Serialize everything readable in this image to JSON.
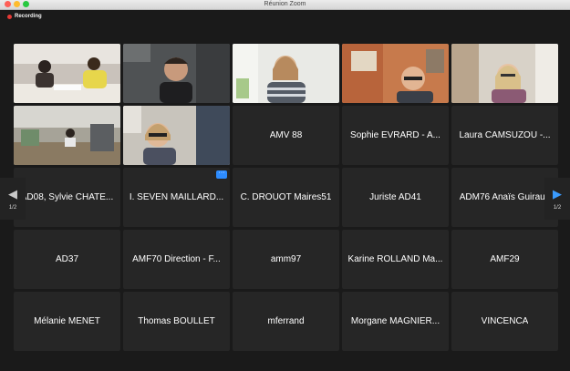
{
  "window": {
    "title": "Réunion Zoom"
  },
  "recording": {
    "label": "Recording"
  },
  "tiles_row1": [
    {
      "name": "video-tile-two-women-desk"
    },
    {
      "name": "video-tile-man-glasses"
    },
    {
      "name": "video-tile-woman-striped"
    },
    {
      "name": "video-tile-man-orange-wall"
    },
    {
      "name": "video-tile-woman-blonde"
    }
  ],
  "tiles": {
    "amv88": "AMV 88",
    "sophie": "Sophie EVRARD  - A...",
    "laura": "Laura CAMSUZOU -...",
    "ad08": "AD08, Sylvie CHATE...",
    "seven": "I. SEVEN MAILLARD...",
    "drouot": "C. DROUOT Maires51",
    "juriste": "Juriste AD41",
    "adm76": "ADM76 Anaïs Guiraud",
    "ad37": "AD37",
    "amf70": "AMF70 Direction - F...",
    "amm97": "amm97",
    "karine": "Karine ROLLAND Ma...",
    "amf29": "AMF29",
    "melanie": "Mélanie MENET",
    "thomas": "Thomas BOULLET",
    "mferrand": "mferrand",
    "morgane": "Morgane MAGNIER...",
    "vincenca": "VINCENCA"
  },
  "pager": {
    "left_label": "1/2",
    "right_label": "1/2",
    "more_glyph": "···"
  },
  "colors": {
    "active_speaker": "#3cc24f",
    "accent": "#2d8cff",
    "recording": "#e53935"
  }
}
